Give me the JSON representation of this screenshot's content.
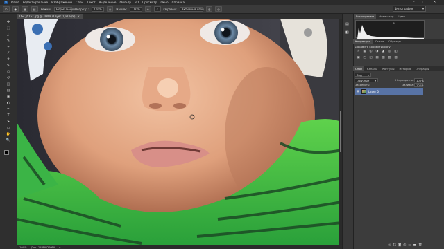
{
  "menubar": {
    "app_icon": "photoshop-logo",
    "items": [
      "Файл",
      "Редактирование",
      "Изображение",
      "Слои",
      "Текст",
      "Выделение",
      "Фильтр",
      "3D",
      "Просмотр",
      "Окно",
      "Справка"
    ]
  },
  "window_controls": {
    "minimize": "–",
    "maximize": "□",
    "close": "✕"
  },
  "options": {
    "mode_label": "Режим:",
    "mode_value": "Нормальный",
    "opacity_label": "Непрозр.:",
    "opacity_value": "100%",
    "flow_label": "Нажим:",
    "flow_value": "100%",
    "sample_checkbox": "✓",
    "sample_label": "Образец:",
    "sample_value": "Активный слой",
    "workspace_value": "Фотография"
  },
  "document_tab": {
    "title": "DSC_6152.jpg @ 100% (Layer 0, RGB/8)",
    "close": "×"
  },
  "status": {
    "zoom": "100%",
    "doc_size": "Док: 14,8M/29,6M"
  },
  "panels": {
    "top_tabs": [
      "Гистограмма",
      "Навигатор",
      "Цвет"
    ],
    "histogram_marker": "⚠",
    "adj_tabs": [
      "Коррекция",
      "Стили",
      "Образцы"
    ],
    "adj_title": "Добавить корректировку",
    "adj_icons_row1": [
      "☼",
      "▦",
      "◐",
      "◑",
      "▲",
      "◎",
      "◧"
    ],
    "adj_icons_row2": [
      "▣",
      "◰",
      "◱",
      "▤",
      "▥",
      "▧",
      "▨"
    ],
    "layer_tabs": [
      "Слои",
      "Каналы",
      "Контуры",
      "История",
      "Операции"
    ],
    "kind_select": "Вид",
    "blend_select": "Обычные",
    "opacity_label": "Непрозрачность:",
    "opacity_value": "100%",
    "lock_label": "Закрепить:",
    "fill_label": "Заливка:",
    "fill_value": "100%",
    "layer_name": "Layer 0",
    "bottom_icons": [
      "∞",
      "fx",
      "◙",
      "◐",
      "▭",
      "▬",
      "🗑"
    ]
  },
  "icons": {
    "tools": [
      "move-icon",
      "marquee-icon",
      "lasso-icon",
      "quick-select-icon",
      "crop-icon",
      "eyedropper-icon",
      "healing-icon",
      "brush-icon",
      "stamp-icon",
      "history-brush-icon",
      "eraser-icon",
      "gradient-icon",
      "blur-icon",
      "dodge-icon",
      "pen-icon",
      "type-icon",
      "path-select-icon",
      "shape-icon",
      "hand-icon",
      "zoom-icon"
    ],
    "tool_glyphs": [
      "✥",
      "⬚",
      "ʆ",
      "✎",
      "⌗",
      "⁄",
      "✚",
      "✎",
      "⎔",
      "↺",
      "◫",
      "▤",
      "◉",
      "◐",
      "✒",
      "T",
      "➤",
      "▭",
      "✋",
      "🔍"
    ]
  },
  "colors": {
    "accent": "#5873a5",
    "foreground": "#000000",
    "background": "#ffffff"
  }
}
